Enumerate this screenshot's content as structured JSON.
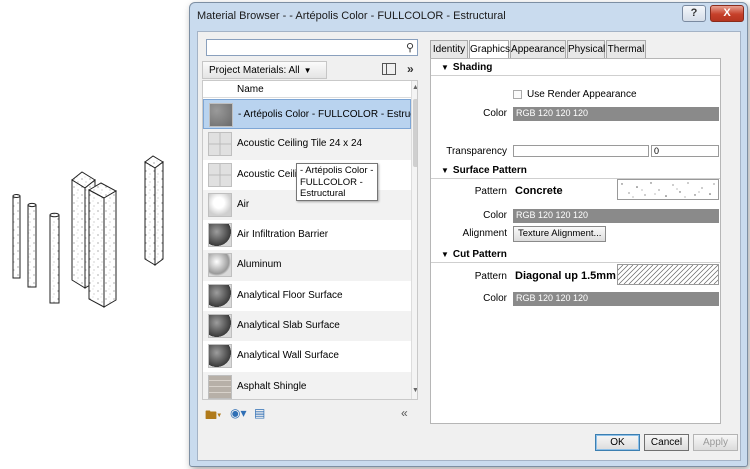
{
  "window": {
    "title": "Material Browser - - Artépolis Color - FULLCOLOR - Estructural",
    "help_label": "?",
    "close_label": "X"
  },
  "left_pane": {
    "search_placeholder": "",
    "filter_label": "Project Materials: All",
    "column_header": "Name",
    "materials": [
      {
        "label": "- Artépolis Color - FULLCOLOR - Estructural",
        "thumb": "concrete-swatch",
        "selected": true
      },
      {
        "label": "Acoustic Ceiling Tile 24 x 24",
        "thumb": "ceiling-tile-swatch"
      },
      {
        "label": "Acoustic Ceiling Tile 24 x 48",
        "thumb": "ceiling-tile-swatch"
      },
      {
        "label": "Air",
        "thumb": "air-swatch"
      },
      {
        "label": "Air Infiltration Barrier",
        "thumb": "sphere-swatch"
      },
      {
        "label": "Aluminum",
        "thumb": "metal-sphere-swatch"
      },
      {
        "label": "Analytical Floor Surface",
        "thumb": "sphere-swatch"
      },
      {
        "label": "Analytical Slab Surface",
        "thumb": "sphere-swatch"
      },
      {
        "label": "Analytical Wall Surface",
        "thumb": "sphere-swatch"
      },
      {
        "label": "Asphalt Shingle",
        "thumb": "shingle-swatch"
      }
    ],
    "tooltip_text": "- Artépolis Color - FULLCOLOR - Estructural"
  },
  "tabs": [
    {
      "label": "Identity",
      "active": false
    },
    {
      "label": "Graphics",
      "active": true
    },
    {
      "label": "Appearance",
      "active": false
    },
    {
      "label": "Physical",
      "active": false
    },
    {
      "label": "Thermal",
      "active": false
    }
  ],
  "shading": {
    "heading": "Shading",
    "use_render_label": "Use Render Appearance",
    "color_label": "Color",
    "color_value": "RGB 120 120 120",
    "transparency_label": "Transparency",
    "transparency_value": "0"
  },
  "surface_pattern": {
    "heading": "Surface Pattern",
    "pattern_label": "Pattern",
    "pattern_value": "Concrete",
    "color_label": "Color",
    "color_value": "RGB 120 120 120",
    "alignment_label": "Alignment",
    "alignment_button": "Texture Alignment..."
  },
  "cut_pattern": {
    "heading": "Cut Pattern",
    "pattern_label": "Pattern",
    "pattern_value": "Diagonal up 1.5mm",
    "color_label": "Color",
    "color_value": "RGB 120 120 120"
  },
  "buttons": {
    "ok": "OK",
    "cancel": "Cancel",
    "apply": "Apply"
  },
  "colors": {
    "selection": "#b9d3ef",
    "swatch_gray": "#8a8a8a",
    "title_bar": "#c9dbee",
    "close_button": "#c6402a"
  }
}
